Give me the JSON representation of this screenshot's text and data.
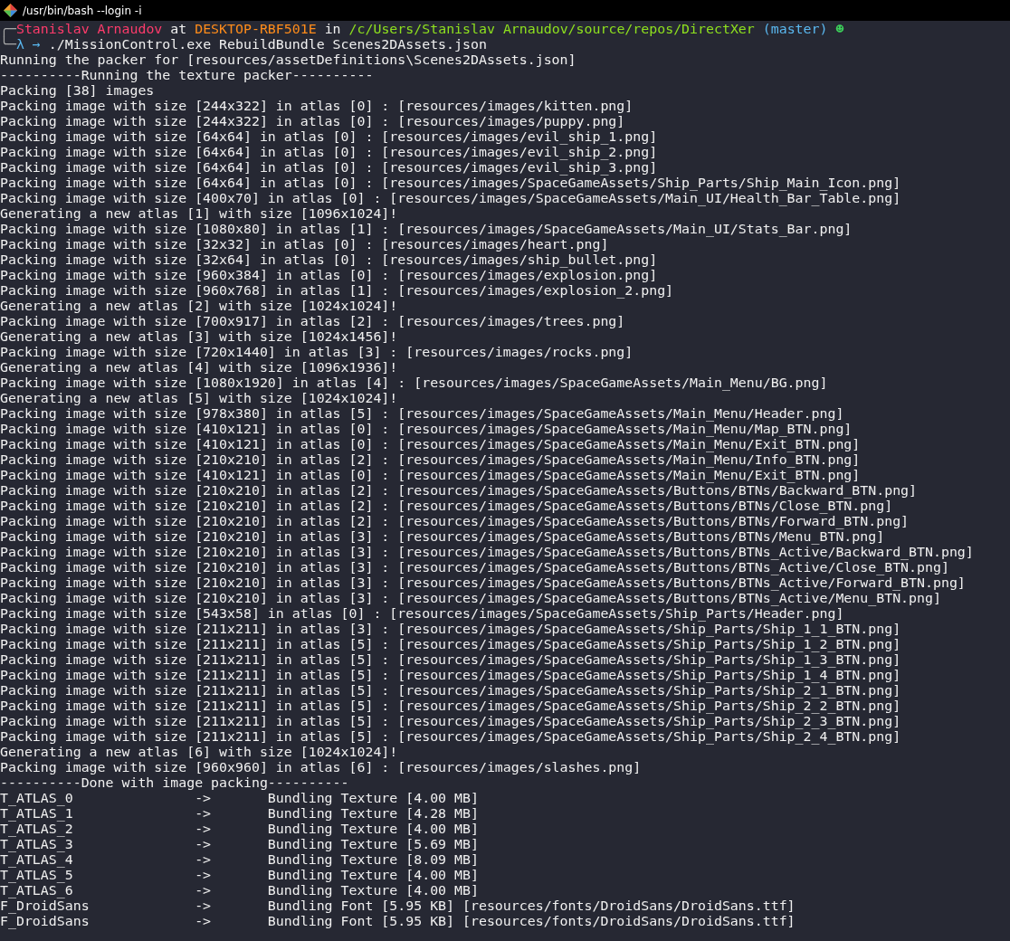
{
  "window": {
    "title": "/usr/bin/bash --login -i"
  },
  "prompt": {
    "corner": "╭─",
    "user": "Stanislav Arnaudov",
    "at": "at",
    "host": "DESKTOP-RBF501E",
    "in": "in",
    "path": "/c/Users/Stanislav Arnaudov/source/repos/DirectXer",
    "branch": "(master)",
    "status": "☻"
  },
  "command": {
    "corner": "╰─",
    "lambda": "λ",
    "arrow": "→",
    "text": "./MissionControl.exe RebuildBundle Scenes2DAssets.json"
  },
  "output": [
    "Running the packer for [resources/assetDefinitions\\Scenes2DAssets.json]",
    "----------Running the texture packer----------",
    "Packing [38] images",
    "Packing image with size [244x322] in atlas [0] : [resources/images/kitten.png]",
    "Packing image with size [244x322] in atlas [0] : [resources/images/puppy.png]",
    "Packing image with size [64x64] in atlas [0] : [resources/images/evil_ship_1.png]",
    "Packing image with size [64x64] in atlas [0] : [resources/images/evil_ship_2.png]",
    "Packing image with size [64x64] in atlas [0] : [resources/images/evil_ship_3.png]",
    "Packing image with size [64x64] in atlas [0] : [resources/images/SpaceGameAssets/Ship_Parts/Ship_Main_Icon.png]",
    "Packing image with size [400x70] in atlas [0] : [resources/images/SpaceGameAssets/Main_UI/Health_Bar_Table.png]",
    "Generating a new atlas [1] with size [1096x1024]!",
    "Packing image with size [1080x80] in atlas [1] : [resources/images/SpaceGameAssets/Main_UI/Stats_Bar.png]",
    "Packing image with size [32x32] in atlas [0] : [resources/images/heart.png]",
    "Packing image with size [32x64] in atlas [0] : [resources/images/ship_bullet.png]",
    "Packing image with size [960x384] in atlas [0] : [resources/images/explosion.png]",
    "Packing image with size [960x768] in atlas [1] : [resources/images/explosion_2.png]",
    "Generating a new atlas [2] with size [1024x1024]!",
    "Packing image with size [700x917] in atlas [2] : [resources/images/trees.png]",
    "Generating a new atlas [3] with size [1024x1456]!",
    "Packing image with size [720x1440] in atlas [3] : [resources/images/rocks.png]",
    "Generating a new atlas [4] with size [1096x1936]!",
    "Packing image with size [1080x1920] in atlas [4] : [resources/images/SpaceGameAssets/Main_Menu/BG.png]",
    "Generating a new atlas [5] with size [1024x1024]!",
    "Packing image with size [978x380] in atlas [5] : [resources/images/SpaceGameAssets/Main_Menu/Header.png]",
    "Packing image with size [410x121] in atlas [0] : [resources/images/SpaceGameAssets/Main_Menu/Map_BTN.png]",
    "Packing image with size [410x121] in atlas [0] : [resources/images/SpaceGameAssets/Main_Menu/Exit_BTN.png]",
    "Packing image with size [210x210] in atlas [2] : [resources/images/SpaceGameAssets/Main_Menu/Info_BTN.png]",
    "Packing image with size [410x121] in atlas [0] : [resources/images/SpaceGameAssets/Main_Menu/Exit_BTN.png]",
    "Packing image with size [210x210] in atlas [2] : [resources/images/SpaceGameAssets/Buttons/BTNs/Backward_BTN.png]",
    "Packing image with size [210x210] in atlas [2] : [resources/images/SpaceGameAssets/Buttons/BTNs/Close_BTN.png]",
    "Packing image with size [210x210] in atlas [2] : [resources/images/SpaceGameAssets/Buttons/BTNs/Forward_BTN.png]",
    "Packing image with size [210x210] in atlas [3] : [resources/images/SpaceGameAssets/Buttons/BTNs/Menu_BTN.png]",
    "Packing image with size [210x210] in atlas [3] : [resources/images/SpaceGameAssets/Buttons/BTNs_Active/Backward_BTN.png]",
    "Packing image with size [210x210] in atlas [3] : [resources/images/SpaceGameAssets/Buttons/BTNs_Active/Close_BTN.png]",
    "Packing image with size [210x210] in atlas [3] : [resources/images/SpaceGameAssets/Buttons/BTNs_Active/Forward_BTN.png]",
    "Packing image with size [210x210] in atlas [3] : [resources/images/SpaceGameAssets/Buttons/BTNs_Active/Menu_BTN.png]",
    "Packing image with size [543x58] in atlas [0] : [resources/images/SpaceGameAssets/Ship_Parts/Header.png]",
    "Packing image with size [211x211] in atlas [3] : [resources/images/SpaceGameAssets/Ship_Parts/Ship_1_1_BTN.png]",
    "Packing image with size [211x211] in atlas [5] : [resources/images/SpaceGameAssets/Ship_Parts/Ship_1_2_BTN.png]",
    "Packing image with size [211x211] in atlas [5] : [resources/images/SpaceGameAssets/Ship_Parts/Ship_1_3_BTN.png]",
    "Packing image with size [211x211] in atlas [5] : [resources/images/SpaceGameAssets/Ship_Parts/Ship_1_4_BTN.png]",
    "Packing image with size [211x211] in atlas [5] : [resources/images/SpaceGameAssets/Ship_Parts/Ship_2_1_BTN.png]",
    "Packing image with size [211x211] in atlas [5] : [resources/images/SpaceGameAssets/Ship_Parts/Ship_2_2_BTN.png]",
    "Packing image with size [211x211] in atlas [5] : [resources/images/SpaceGameAssets/Ship_Parts/Ship_2_3_BTN.png]",
    "Packing image with size [211x211] in atlas [5] : [resources/images/SpaceGameAssets/Ship_Parts/Ship_2_4_BTN.png]",
    "Generating a new atlas [6] with size [1024x1024]!",
    "Packing image with size [960x960] in atlas [6] : [resources/images/slashes.png]",
    "----------Done with image packing----------",
    "T_ATLAS_0               ->       Bundling Texture [4.00 MB]",
    "T_ATLAS_1               ->       Bundling Texture [4.28 MB]",
    "T_ATLAS_2               ->       Bundling Texture [4.00 MB]",
    "T_ATLAS_3               ->       Bundling Texture [5.69 MB]",
    "T_ATLAS_4               ->       Bundling Texture [8.09 MB]",
    "T_ATLAS_5               ->       Bundling Texture [4.00 MB]",
    "T_ATLAS_6               ->       Bundling Texture [4.00 MB]",
    "F_DroidSans             ->       Bundling Font [5.95 KB] [resources/fonts/DroidSans/DroidSans.ttf]",
    "F_DroidSans             ->       Bundling Font [5.95 KB] [resources/fonts/DroidSans/DroidSans.ttf]"
  ]
}
